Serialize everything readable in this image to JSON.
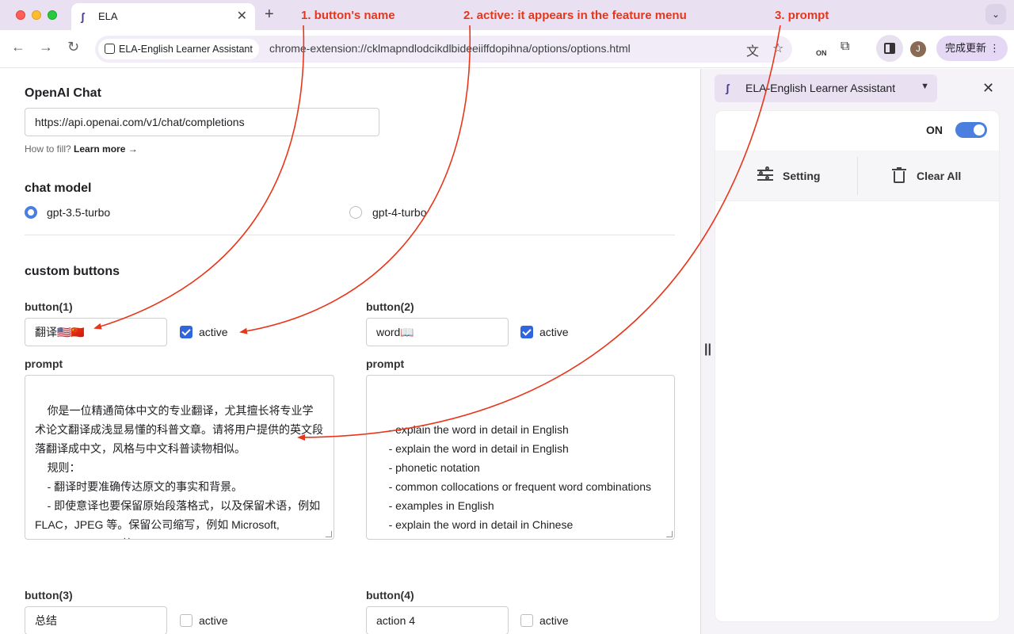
{
  "browser": {
    "tab_title": "ELA",
    "tab_close": "✕",
    "new_tab": "+",
    "tab_menu": "⌄",
    "site_chip": "ELA-English Learner Assistant",
    "url": "chrome-extension://cklmapndlodcikdlbideeiiffdopihna/options/options.html",
    "translate_ext_badge": "ON",
    "avatar_initial": "J",
    "update_button": "完成更新",
    "update_menu": "⋮"
  },
  "options": {
    "openai_title": "OpenAI Chat",
    "api_url": "https://api.openai.com/v1/chat/completions",
    "hint_prefix": "How to fill? ",
    "hint_link": "Learn more →",
    "chat_model_title": "chat model",
    "models": [
      {
        "label": "gpt-3.5-turbo",
        "selected": true
      },
      {
        "label": "gpt-4-turbo",
        "selected": false
      }
    ],
    "custom_buttons_title": "custom buttons",
    "active_label": "active",
    "prompt_label": "prompt",
    "buttons": [
      {
        "heading": "button(1)",
        "name": "翻译🇺🇸🇨🇳",
        "active": true,
        "prompt": "你是一位精通简体中文的专业翻译，尤其擅长将专业学术论文翻译成浅显易懂的科普文章。请将用户提供的英文段落翻译成中文，风格与中文科普读物相似。\n    规则：\n    - 翻译时要准确传达原文的事实和背景。\n    - 即使意译也要保留原始段落格式，以及保留术语，例如 FLAC，JPEG 等。保留公司缩写，例如 Microsoft, Amazon, OpenAI 等。\n    - 人名不翻译"
      },
      {
        "heading": "button(2)",
        "name": "word📖",
        "active": true,
        "prompt": "\n    - explain the word in detail in English\n    - explain the word in detail in English\n    - phonetic notation\n    - common collocations or frequent word combinations\n    - examples in English\n    - explain the word in detail in Chinese"
      },
      {
        "heading": "button(3)",
        "name": "总结",
        "active": false
      },
      {
        "heading": "button(4)",
        "name": "action 4",
        "active": false
      }
    ]
  },
  "side_panel": {
    "extension_name": "ELA-English Learner Assistant",
    "close": "✕",
    "on_label": "ON",
    "toggle_on": true,
    "setting_label": "Setting",
    "clear_all_label": "Clear All",
    "grip": "||"
  },
  "annotations": {
    "one": "1. button's name",
    "two": "2. active: it appears in the feature menu",
    "three": "3. prompt",
    "color": "#e8361a"
  }
}
